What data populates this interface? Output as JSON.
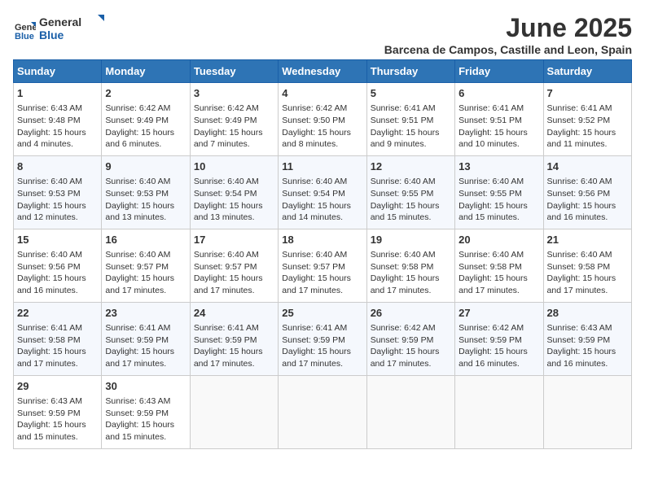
{
  "header": {
    "logo_general": "General",
    "logo_blue": "Blue",
    "title": "June 2025",
    "subtitle": "Barcena de Campos, Castille and Leon, Spain"
  },
  "days_of_week": [
    "Sunday",
    "Monday",
    "Tuesday",
    "Wednesday",
    "Thursday",
    "Friday",
    "Saturday"
  ],
  "weeks": [
    [
      {
        "day": "1",
        "sunrise": "Sunrise: 6:43 AM",
        "sunset": "Sunset: 9:48 PM",
        "daylight": "Daylight: 15 hours and 4 minutes."
      },
      {
        "day": "2",
        "sunrise": "Sunrise: 6:42 AM",
        "sunset": "Sunset: 9:49 PM",
        "daylight": "Daylight: 15 hours and 6 minutes."
      },
      {
        "day": "3",
        "sunrise": "Sunrise: 6:42 AM",
        "sunset": "Sunset: 9:49 PM",
        "daylight": "Daylight: 15 hours and 7 minutes."
      },
      {
        "day": "4",
        "sunrise": "Sunrise: 6:42 AM",
        "sunset": "Sunset: 9:50 PM",
        "daylight": "Daylight: 15 hours and 8 minutes."
      },
      {
        "day": "5",
        "sunrise": "Sunrise: 6:41 AM",
        "sunset": "Sunset: 9:51 PM",
        "daylight": "Daylight: 15 hours and 9 minutes."
      },
      {
        "day": "6",
        "sunrise": "Sunrise: 6:41 AM",
        "sunset": "Sunset: 9:51 PM",
        "daylight": "Daylight: 15 hours and 10 minutes."
      },
      {
        "day": "7",
        "sunrise": "Sunrise: 6:41 AM",
        "sunset": "Sunset: 9:52 PM",
        "daylight": "Daylight: 15 hours and 11 minutes."
      }
    ],
    [
      {
        "day": "8",
        "sunrise": "Sunrise: 6:40 AM",
        "sunset": "Sunset: 9:53 PM",
        "daylight": "Daylight: 15 hours and 12 minutes."
      },
      {
        "day": "9",
        "sunrise": "Sunrise: 6:40 AM",
        "sunset": "Sunset: 9:53 PM",
        "daylight": "Daylight: 15 hours and 13 minutes."
      },
      {
        "day": "10",
        "sunrise": "Sunrise: 6:40 AM",
        "sunset": "Sunset: 9:54 PM",
        "daylight": "Daylight: 15 hours and 13 minutes."
      },
      {
        "day": "11",
        "sunrise": "Sunrise: 6:40 AM",
        "sunset": "Sunset: 9:54 PM",
        "daylight": "Daylight: 15 hours and 14 minutes."
      },
      {
        "day": "12",
        "sunrise": "Sunrise: 6:40 AM",
        "sunset": "Sunset: 9:55 PM",
        "daylight": "Daylight: 15 hours and 15 minutes."
      },
      {
        "day": "13",
        "sunrise": "Sunrise: 6:40 AM",
        "sunset": "Sunset: 9:55 PM",
        "daylight": "Daylight: 15 hours and 15 minutes."
      },
      {
        "day": "14",
        "sunrise": "Sunrise: 6:40 AM",
        "sunset": "Sunset: 9:56 PM",
        "daylight": "Daylight: 15 hours and 16 minutes."
      }
    ],
    [
      {
        "day": "15",
        "sunrise": "Sunrise: 6:40 AM",
        "sunset": "Sunset: 9:56 PM",
        "daylight": "Daylight: 15 hours and 16 minutes."
      },
      {
        "day": "16",
        "sunrise": "Sunrise: 6:40 AM",
        "sunset": "Sunset: 9:57 PM",
        "daylight": "Daylight: 15 hours and 17 minutes."
      },
      {
        "day": "17",
        "sunrise": "Sunrise: 6:40 AM",
        "sunset": "Sunset: 9:57 PM",
        "daylight": "Daylight: 15 hours and 17 minutes."
      },
      {
        "day": "18",
        "sunrise": "Sunrise: 6:40 AM",
        "sunset": "Sunset: 9:57 PM",
        "daylight": "Daylight: 15 hours and 17 minutes."
      },
      {
        "day": "19",
        "sunrise": "Sunrise: 6:40 AM",
        "sunset": "Sunset: 9:58 PM",
        "daylight": "Daylight: 15 hours and 17 minutes."
      },
      {
        "day": "20",
        "sunrise": "Sunrise: 6:40 AM",
        "sunset": "Sunset: 9:58 PM",
        "daylight": "Daylight: 15 hours and 17 minutes."
      },
      {
        "day": "21",
        "sunrise": "Sunrise: 6:40 AM",
        "sunset": "Sunset: 9:58 PM",
        "daylight": "Daylight: 15 hours and 17 minutes."
      }
    ],
    [
      {
        "day": "22",
        "sunrise": "Sunrise: 6:41 AM",
        "sunset": "Sunset: 9:58 PM",
        "daylight": "Daylight: 15 hours and 17 minutes."
      },
      {
        "day": "23",
        "sunrise": "Sunrise: 6:41 AM",
        "sunset": "Sunset: 9:59 PM",
        "daylight": "Daylight: 15 hours and 17 minutes."
      },
      {
        "day": "24",
        "sunrise": "Sunrise: 6:41 AM",
        "sunset": "Sunset: 9:59 PM",
        "daylight": "Daylight: 15 hours and 17 minutes."
      },
      {
        "day": "25",
        "sunrise": "Sunrise: 6:41 AM",
        "sunset": "Sunset: 9:59 PM",
        "daylight": "Daylight: 15 hours and 17 minutes."
      },
      {
        "day": "26",
        "sunrise": "Sunrise: 6:42 AM",
        "sunset": "Sunset: 9:59 PM",
        "daylight": "Daylight: 15 hours and 17 minutes."
      },
      {
        "day": "27",
        "sunrise": "Sunrise: 6:42 AM",
        "sunset": "Sunset: 9:59 PM",
        "daylight": "Daylight: 15 hours and 16 minutes."
      },
      {
        "day": "28",
        "sunrise": "Sunrise: 6:43 AM",
        "sunset": "Sunset: 9:59 PM",
        "daylight": "Daylight: 15 hours and 16 minutes."
      }
    ],
    [
      {
        "day": "29",
        "sunrise": "Sunrise: 6:43 AM",
        "sunset": "Sunset: 9:59 PM",
        "daylight": "Daylight: 15 hours and 15 minutes."
      },
      {
        "day": "30",
        "sunrise": "Sunrise: 6:43 AM",
        "sunset": "Sunset: 9:59 PM",
        "daylight": "Daylight: 15 hours and 15 minutes."
      },
      null,
      null,
      null,
      null,
      null
    ]
  ]
}
